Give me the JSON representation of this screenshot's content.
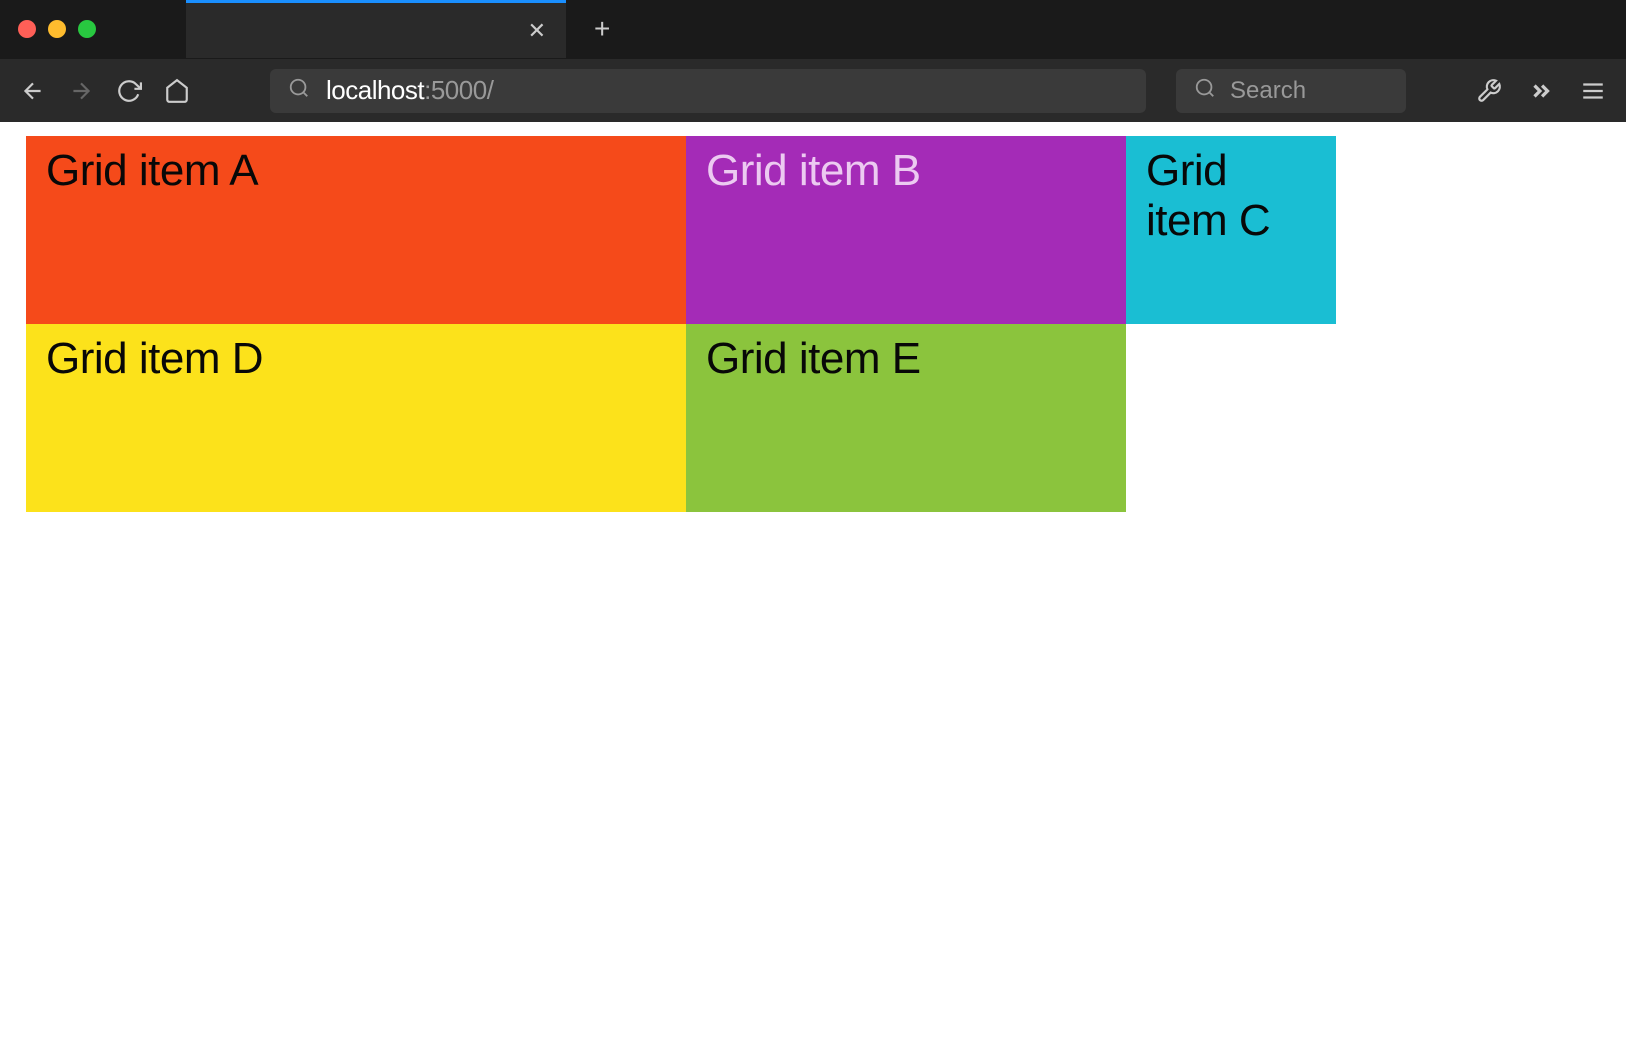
{
  "browser": {
    "url_host": "localhost",
    "url_port_path": ":5000/",
    "search_placeholder": "Search"
  },
  "grid": {
    "items": [
      {
        "label": "Grid item A",
        "color": "#f54a1a"
      },
      {
        "label": "Grid item B",
        "color": "#a42bb7"
      },
      {
        "label": "Grid item C",
        "color": "#1abed3"
      },
      {
        "label": "Grid item D",
        "color": "#fce21b"
      },
      {
        "label": "Grid item E",
        "color": "#8bc43d"
      }
    ]
  }
}
